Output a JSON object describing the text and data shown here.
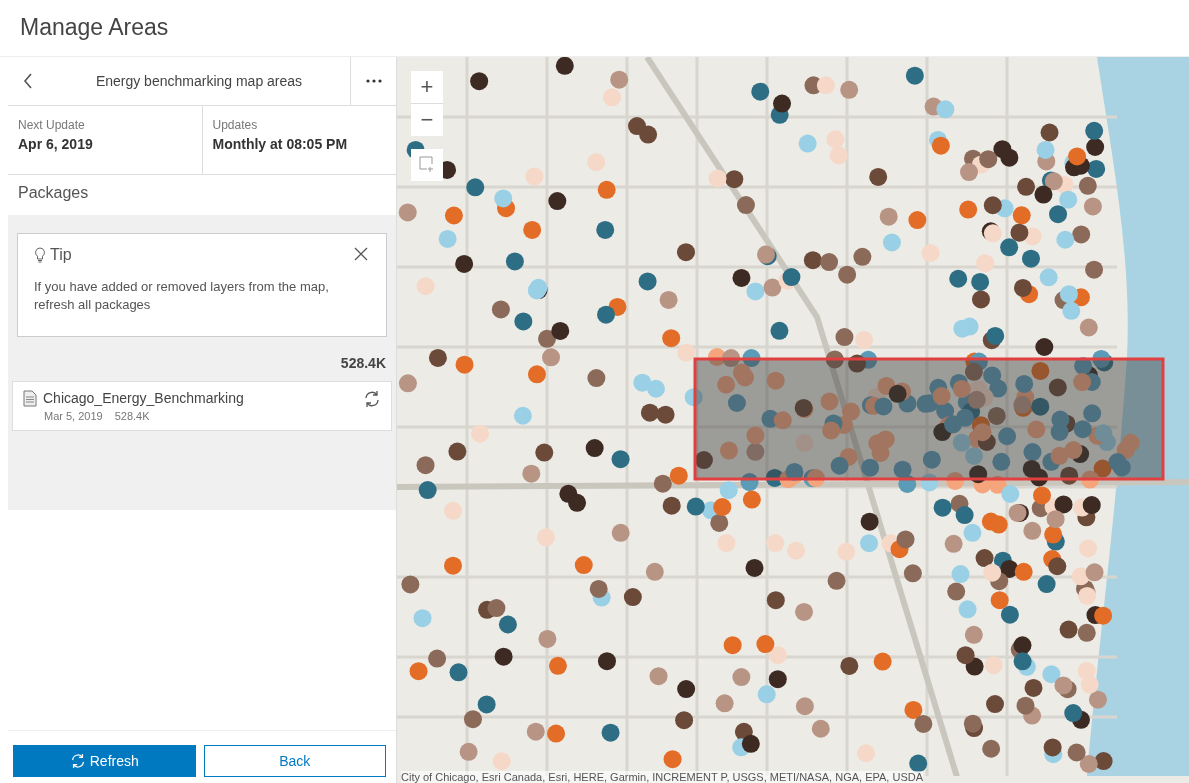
{
  "page_title": "Manage Areas",
  "panel": {
    "title": "Energy benchmarking map areas",
    "info": [
      {
        "label": "Next Update",
        "value": "Apr 6, 2019"
      },
      {
        "label": "Updates",
        "value": "Monthly at 08:05 PM"
      }
    ],
    "section_title": "Packages",
    "tip": {
      "title": "Tip",
      "text": "If you have added or removed layers from the map, refresh all packages"
    },
    "total_size": "528.4K",
    "packages": [
      {
        "name": "Chicago_Energy_Benchmarking",
        "date": "Mar 5, 2019",
        "size": "528.4K"
      }
    ],
    "buttons": [
      {
        "label": "Refresh",
        "kind": "primary"
      },
      {
        "label": "Back",
        "kind": "secondary"
      }
    ]
  },
  "map": {
    "zoom_in": "+",
    "zoom_out": "−",
    "attribution": "City of Chicago, Esri Canada, Esri, HERE, Garmin, INCREMENT P, USGS, METI/NASA, NGA, EPA, USDA"
  }
}
